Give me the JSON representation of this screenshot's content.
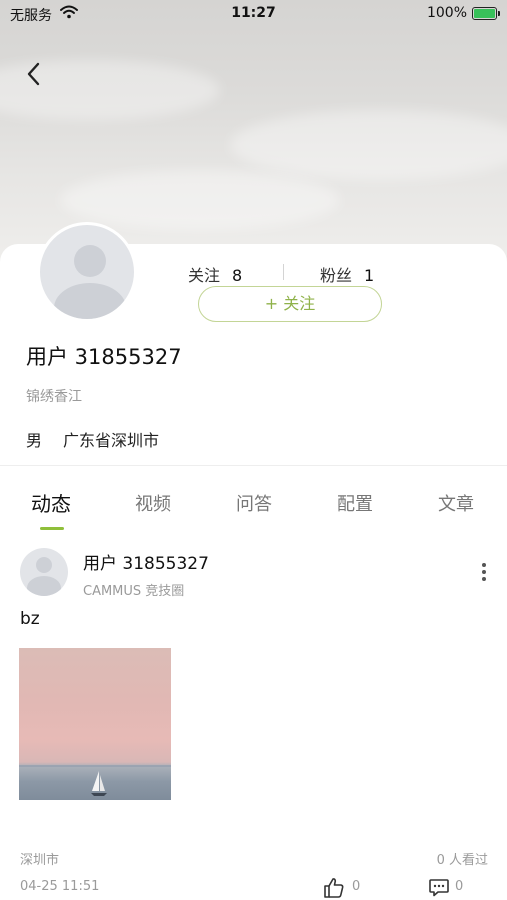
{
  "status_bar": {
    "carrier": "无服务",
    "time": "11:27",
    "battery": "100%",
    "battery_level": 1.0,
    "icons": [
      "wifi-icon",
      "battery-icon"
    ]
  },
  "header": {
    "back_icon": "chevron-left-icon"
  },
  "profile": {
    "following_label": "关注",
    "following_count": "8",
    "followers_label": "粉丝",
    "followers_count": "1",
    "follow_button_label": "+ 关注",
    "username": "用户 31855327",
    "community": "锦绣香江",
    "gender": "男",
    "location": "广东省深圳市",
    "avatar_icon": "default-avatar-icon"
  },
  "tabs": [
    {
      "label": "动态",
      "active": true
    },
    {
      "label": "视频",
      "active": false
    },
    {
      "label": "问答",
      "active": false
    },
    {
      "label": "配置",
      "active": false
    },
    {
      "label": "文章",
      "active": false
    }
  ],
  "post": {
    "author": "用户 31855327",
    "circle": "CAMMUS 竞技圈",
    "text": "bz",
    "location": "深圳市",
    "views": "0 人看过",
    "time": "04-25 11:51",
    "likes": "0",
    "comments": "0",
    "icons": [
      "more-vertical-icon",
      "thumbs-up-icon",
      "comment-icon"
    ]
  },
  "colors": {
    "accent_green": "#8fbf3a",
    "follow_text": "#8fb24a",
    "follow_border": "#c3d596",
    "muted_text": "#9a9a9a"
  }
}
